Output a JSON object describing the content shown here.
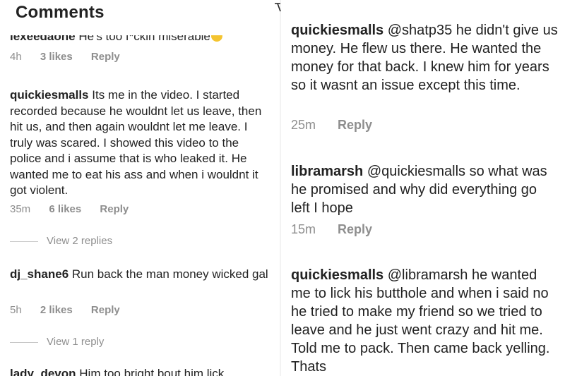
{
  "header": {
    "title": "Comments"
  },
  "left": {
    "cut_comment": {
      "user": "lexeedaone",
      "text": "He's too f*ckin miserable"
    },
    "comments": [
      {
        "user": "quickiesmalls",
        "text": "Its me in the video.  I started recorded because he wouldnt let us leave, then hit us, and then again wouldnt let me leave. I truly was scared. I showed this video to the police and i assume that is who leaked it. He wanted me to eat his ass and when i wouldnt it got violent.",
        "time": "35m",
        "likes": "6 likes",
        "reply": "Reply",
        "view_replies": "View 2 replies"
      },
      {
        "user": "dj_shane6",
        "text": "Run back the man money wicked gal",
        "time": "5h",
        "likes": "2 likes",
        "reply": "Reply",
        "view_replies": "View 1 reply"
      }
    ],
    "first_meta": {
      "time": "4h",
      "likes": "3 likes",
      "reply": "Reply"
    },
    "cut_bottom": {
      "user": "lady_devon",
      "text": "Him too bright bout him lick"
    }
  },
  "right": {
    "comments": [
      {
        "user": "quickiesmalls",
        "text": "@shatp35 he didn't give us money. He flew us there. He wanted the money for that back. I knew him for years so it wasnt an issue except this time.",
        "time": "25m",
        "reply": "Reply"
      },
      {
        "user": "libramarsh",
        "text": "@quickiesmalls so what was he promised and why did everything go left I hope",
        "time": "15m",
        "reply": "Reply"
      },
      {
        "user": "quickiesmalls",
        "text": "@libramarsh he wanted me to lick his butthole and when i said no he tried to make my friend so we tried to leave and he just went crazy and hit me. Told me to pack. Then came back yelling. Thats"
      }
    ]
  }
}
